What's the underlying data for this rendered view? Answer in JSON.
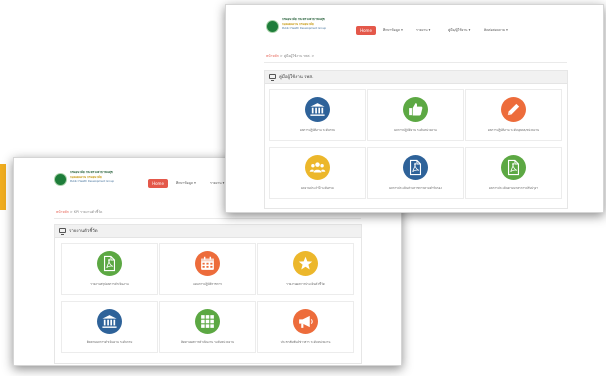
{
  "colors": {
    "accent": "#e4584a",
    "yellow": "#f0ad1f",
    "green": "#5ca843",
    "orange": "#ed6c3b",
    "gold": "#ecb72b",
    "darkblue": "#2e6299",
    "header_green": "#1e7d3a"
  },
  "logo": {
    "line1": "กรมอนามัย กระทรวงสาธารณสุข",
    "line2": "กองแผนงาน กรมอนามัย",
    "line3": "Public Health Development Group"
  },
  "front": {
    "nav": {
      "home": "Home",
      "items": [
        "ศึกษาข้อมูล ▾",
        "รายงาน ▾",
        "คู่มือ/ผู้ใช้งาน ▾",
        "ติดต่อสอบถาม ▾"
      ]
    },
    "breadcrumb": {
      "home": "หน้าหลัก",
      "trail": " > คู่มือผู้ใช้งาน รพส. >"
    },
    "panel_title": "คู่มือผู้ใช้งาน รพส.",
    "tiles": [
      {
        "icon": "bank-icon",
        "label": "ผลการปฏิบัติงาน ระดับกรม"
      },
      {
        "icon": "thumbs-up-icon",
        "label": "ผลการปฏิบัติงาน ระดับหน่วยงาน"
      },
      {
        "icon": "pencil-icon",
        "label": "ผลการปฏิบัติงาน ระดับบุคคล/หน่วยงาน"
      },
      {
        "icon": "users-icon",
        "label": "ผลงานประจำปี ระดับกรม"
      },
      {
        "icon": "pdf-icon",
        "label": "ผลการประเมินส่วนราชการตามคำรับรอง"
      },
      {
        "icon": "pdf-icon",
        "label": "ผลการประเมินตามมาตรการปรับปรุงฯ"
      }
    ]
  },
  "back": {
    "nav": {
      "home": "Home",
      "items": [
        "ศึกษาข้อมูล ▾",
        "รายงาน ▾"
      ]
    },
    "breadcrumb": {
      "home": "หน้าหลัก",
      "trail": " > KPI รายงานตัวชี้วัด"
    },
    "panel_title": "รายงานตัวชี้วัด",
    "tiles": [
      {
        "icon": "pdf-icon",
        "label": "รายงานสรุปผลการดำเนินงาน"
      },
      {
        "icon": "calendar-icon",
        "label": "แผนการปฏิบัติราชการ"
      },
      {
        "icon": "star-icon",
        "label": "รายงานผลการประเมินตัวชี้วัด"
      },
      {
        "icon": "bank-icon",
        "label": "ติดตามผลการดำเนินงาน ระดับกรม"
      },
      {
        "icon": "grid-icon",
        "label": "ติดตามผลการดำเนินงาน ระดับหน่วยงาน"
      },
      {
        "icon": "megaphone-icon",
        "label": "ประชาสัมพันธ์ข่าวสาร ระดับหน่วยงาน"
      }
    ]
  }
}
